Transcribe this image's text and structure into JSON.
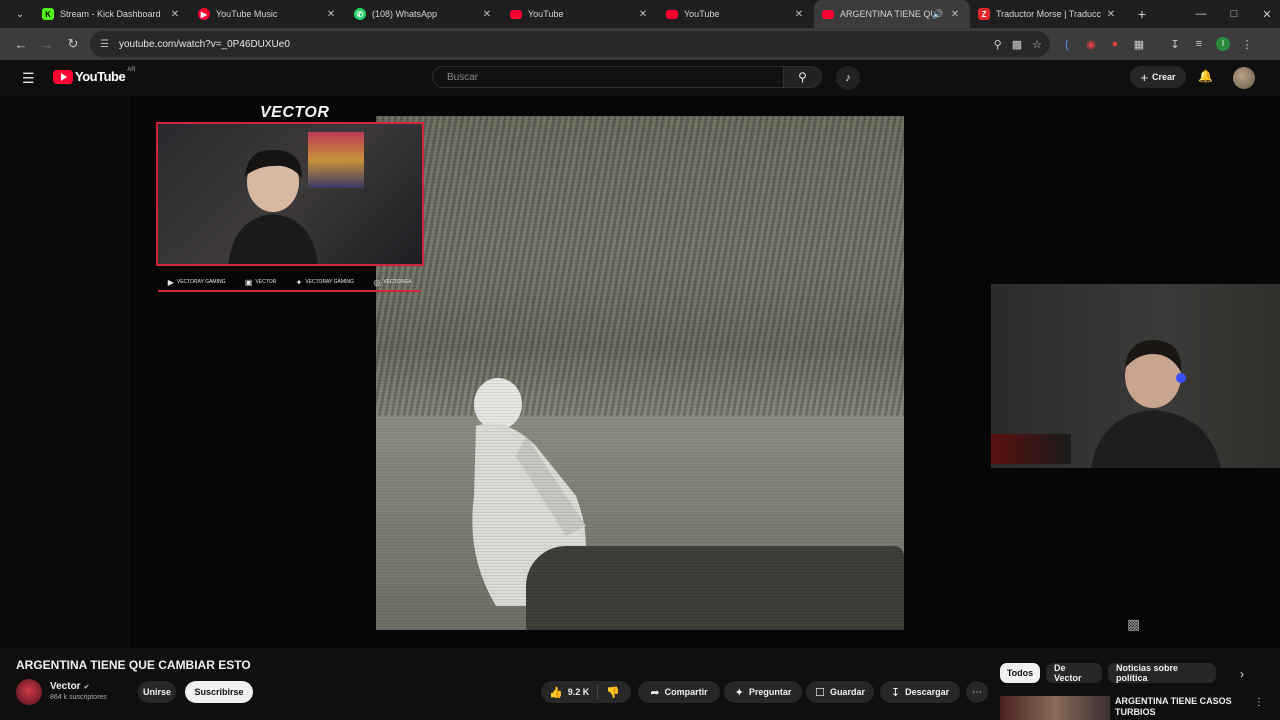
{
  "browser": {
    "tabs": [
      {
        "label": "Stream - Kick Dashboard",
        "icon": "kick-icon",
        "color": "#53fc18"
      },
      {
        "label": "YouTube Music",
        "icon": "youtube-music-icon",
        "color": "#ff0033"
      },
      {
        "label": "(108) WhatsApp",
        "icon": "whatsapp-icon",
        "color": "#25d366"
      },
      {
        "label": "YouTube",
        "icon": "youtube-icon",
        "color": "#ff0033"
      },
      {
        "label": "YouTube",
        "icon": "youtube-icon",
        "color": "#ff0033"
      },
      {
        "label": "ARGENTINA TIENE QUE",
        "icon": "youtube-icon",
        "color": "#ff0033",
        "active": true
      },
      {
        "label": "Traductor Morse | Traducc",
        "icon": "translator-icon",
        "color": "#e0262a"
      }
    ],
    "url": "youtube.com/watch?v=_0P46DUXUe0"
  },
  "youtube": {
    "logo_text": "YouTube",
    "country_code": "AR",
    "search_placeholder": "Buscar",
    "create_label": "Crear"
  },
  "overlay": {
    "brand": "VECTOR",
    "socials": [
      {
        "icon": "youtube-icon",
        "text": "VECTORAY GAMING"
      },
      {
        "icon": "kick-icon",
        "text": "VECTOR"
      },
      {
        "icon": "twitter-icon",
        "text": "VECTORAY GAMING"
      },
      {
        "icon": "instagram-icon",
        "text": "VECTORGA"
      }
    ]
  },
  "video": {
    "title": "ARGENTINA TIENE QUE CAMBIAR ESTO",
    "channel": "Vector",
    "subscribers": "864 k suscriptores",
    "join_label": "Unirse",
    "subscribe_label": "Suscribirse",
    "likes": "9.2 K",
    "share_label": "Compartir",
    "ask_label": "Preguntar",
    "save_label": "Guardar",
    "download_label": "Descargar"
  },
  "sidebar": {
    "chips": [
      "Todos",
      "De Vector",
      "Noticias sobre política"
    ],
    "recommendation_title": "ARGENTINA TIENE CASOS TURBIOS"
  },
  "colors": {
    "accent": "#ff0033",
    "overlay_border": "#d0253a",
    "background": "#0f0f0f"
  }
}
